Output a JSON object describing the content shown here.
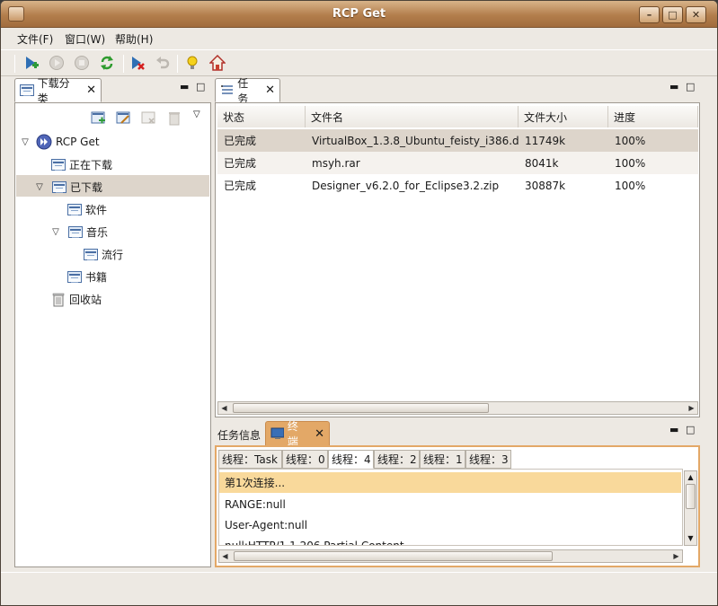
{
  "window": {
    "title": "RCP Get"
  },
  "menu": [
    "文件(F)",
    "窗口(W)",
    "帮助(H)"
  ],
  "toolbar": {
    "icons": [
      "new-task-icon",
      "start-icon",
      "stop-icon",
      "refresh-icon",
      "delete-task-icon",
      "undo-icon",
      "tip-icon",
      "home-icon"
    ]
  },
  "left_panel": {
    "tab_label": "下载分类",
    "tree": [
      {
        "label": "RCP Get",
        "level": 0,
        "expanded": true
      },
      {
        "label": "正在下载",
        "level": 1
      },
      {
        "label": "已下载",
        "level": 1,
        "expanded": true,
        "selected": true
      },
      {
        "label": "软件",
        "level": 2
      },
      {
        "label": "音乐",
        "level": 2,
        "expanded": true
      },
      {
        "label": "流行",
        "level": 3
      },
      {
        "label": "书籍",
        "level": 2
      },
      {
        "label": "回收站",
        "level": 1
      }
    ]
  },
  "task_panel": {
    "tab_label": "任务",
    "columns": [
      "状态",
      "文件名",
      "文件大小",
      "进度"
    ],
    "rows": [
      {
        "status": "已完成",
        "filename": "VirtualBox_1.3.8_Ubuntu_feisty_i386.d",
        "size": "11749k",
        "progress": "100%"
      },
      {
        "status": "已完成",
        "filename": "msyh.rar",
        "size": "8041k",
        "progress": "100%"
      },
      {
        "status": "已完成",
        "filename": "Designer_v6.2.0_for_Eclipse3.2.zip",
        "size": "30887k",
        "progress": "100%"
      }
    ]
  },
  "bottom_panel": {
    "tabs": [
      "任务信息",
      "终端"
    ],
    "thread_tabs": [
      "线程：Task",
      "线程：0",
      "线程：4",
      "线程：2",
      "线程：1",
      "线程：3"
    ],
    "selected_thread": 2,
    "console_lines": [
      "第1次连接...",
      "RANGE:null",
      "User-Agent:null",
      "null:HTTP/1.1 206 Partial Content"
    ]
  },
  "colors": {
    "title": "#b37e4c",
    "selection": "#ddd5cb",
    "highlight": "#f9d99b",
    "accent": "#e3a867"
  }
}
